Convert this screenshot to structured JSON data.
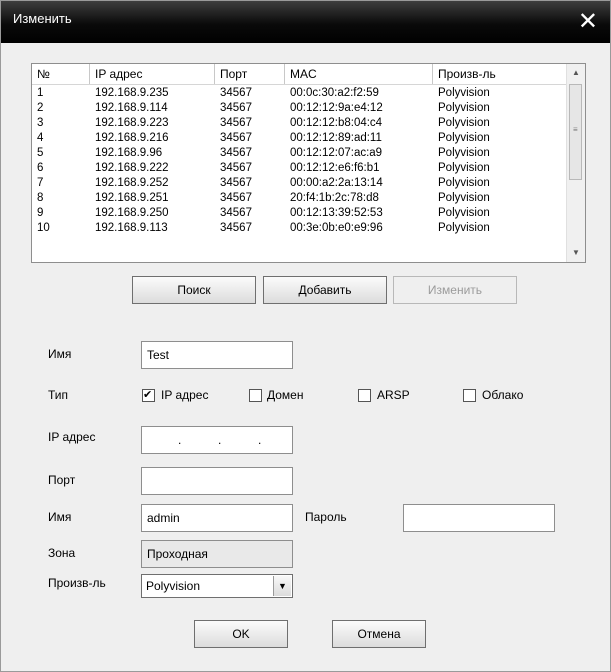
{
  "window": {
    "title": "Изменить",
    "close_icon": "close-icon"
  },
  "devices": {
    "columns": [
      "№",
      "IP адрес",
      "Порт",
      "MAC",
      "Произв-ль"
    ],
    "rows": [
      [
        "1",
        "192.168.9.235",
        "34567",
        "00:0c:30:a2:f2:59",
        "Polyvision"
      ],
      [
        "2",
        "192.168.9.114",
        "34567",
        "00:12:12:9a:e4:12",
        "Polyvision"
      ],
      [
        "3",
        "192.168.9.223",
        "34567",
        "00:12:12:b8:04:c4",
        "Polyvision"
      ],
      [
        "4",
        "192.168.9.216",
        "34567",
        "00:12:12:89:ad:11",
        "Polyvision"
      ],
      [
        "5",
        "192.168.9.96",
        "34567",
        "00:12:12:07:ac:a9",
        "Polyvision"
      ],
      [
        "6",
        "192.168.9.222",
        "34567",
        "00:12:12:e6:f6:b1",
        "Polyvision"
      ],
      [
        "7",
        "192.168.9.252",
        "34567",
        "00:00:a2:2a:13:14",
        "Polyvision"
      ],
      [
        "8",
        "192.168.9.251",
        "34567",
        "20:f4:1b:2c:78:d8",
        "Polyvision"
      ],
      [
        "9",
        "192.168.9.250",
        "34567",
        "00:12:13:39:52:53",
        "Polyvision"
      ],
      [
        "10",
        "192.168.9.113",
        "34567",
        "00:3e:0b:e0:e9:96",
        "Polyvision"
      ]
    ]
  },
  "buttons": {
    "search": "Поиск",
    "add": "Добавить",
    "edit": "Изменить",
    "ok": "OK",
    "cancel": "Отмена"
  },
  "form": {
    "name_label": "Имя",
    "name_value": "Test",
    "type_label": "Тип",
    "types": [
      {
        "label": "IP адрес",
        "checked": true
      },
      {
        "label": "Домен",
        "checked": false
      },
      {
        "label": "ARSP",
        "checked": false
      },
      {
        "label": "Облако",
        "checked": false
      }
    ],
    "ip_label": "IP адрес",
    "port_label": "Порт",
    "port_value": "",
    "user_label": "Имя",
    "user_value": "admin",
    "password_label": "Пароль",
    "password_value": "",
    "zone_label": "Зона",
    "zone_value": "Проходная",
    "vendor_label": "Произв-ль",
    "vendor_value": "Polyvision"
  }
}
